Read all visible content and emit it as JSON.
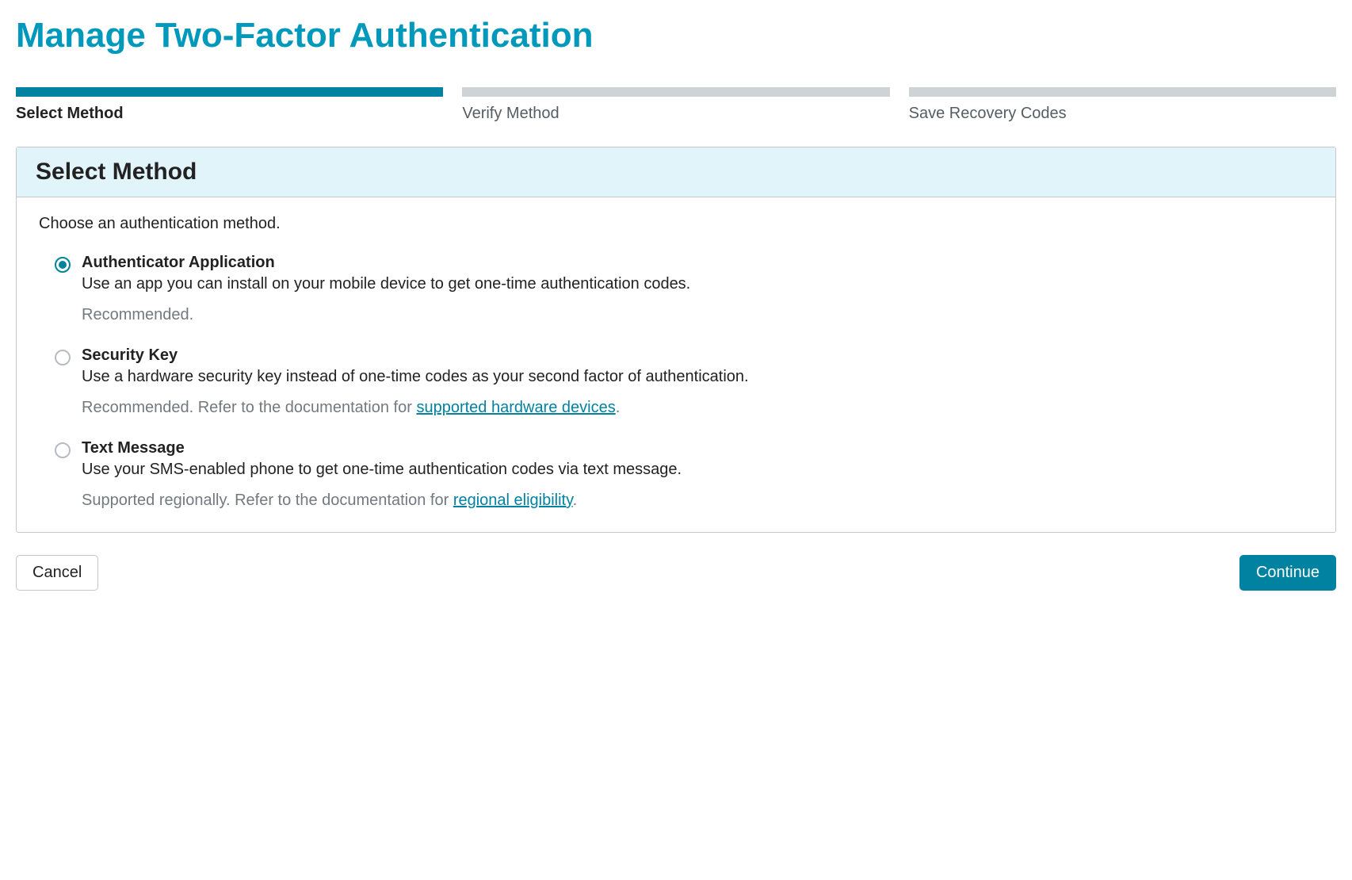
{
  "page": {
    "title": "Manage Two-Factor Authentication"
  },
  "steps": [
    {
      "label": "Select Method",
      "active": true
    },
    {
      "label": "Verify Method",
      "active": false
    },
    {
      "label": "Save Recovery Codes",
      "active": false
    }
  ],
  "panel": {
    "header": "Select Method",
    "intro": "Choose an authentication method."
  },
  "methods": [
    {
      "id": "authenticator",
      "checked": true,
      "title": "Authenticator Application",
      "description": "Use an app you can install on your mobile device to get one-time authentication codes.",
      "note_before": "Recommended.",
      "link_text": "",
      "note_after": ""
    },
    {
      "id": "security-key",
      "checked": false,
      "title": "Security Key",
      "description": "Use a hardware security key instead of one-time codes as your second factor of authentication.",
      "note_before": "Recommended. Refer to the documentation for ",
      "link_text": "supported hardware devices",
      "note_after": "."
    },
    {
      "id": "text-message",
      "checked": false,
      "title": "Text Message",
      "description": "Use your SMS-enabled phone to get one-time authentication codes via text message.",
      "note_before": "Supported regionally. Refer to the documentation for ",
      "link_text": "regional eligibility",
      "note_after": "."
    }
  ],
  "actions": {
    "cancel": "Cancel",
    "continue": "Continue"
  }
}
